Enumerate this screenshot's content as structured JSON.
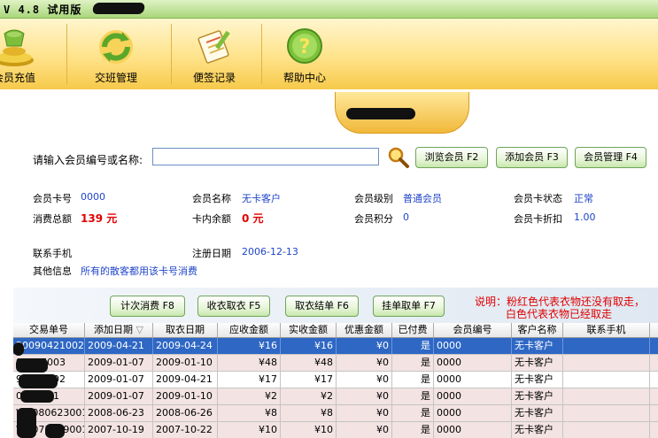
{
  "window": {
    "title": "V 4.8 试用版"
  },
  "toolbar": {
    "buttons": [
      {
        "label": "会员充值",
        "icon": "coins-icon"
      },
      {
        "label": "交班管理",
        "icon": "refresh-icon"
      },
      {
        "label": "便签记录",
        "icon": "notepad-icon"
      },
      {
        "label": "帮助中心",
        "icon": "help-icon"
      }
    ]
  },
  "search": {
    "label": "请输入会员编号或名称:",
    "value": "",
    "placeholder": ""
  },
  "actions": {
    "browse": "浏览会员 F2",
    "add": "添加会员 F3",
    "manage": "会员管理 F4"
  },
  "member": {
    "card_no_label": "会员卡号",
    "card_no": "0000",
    "name_label": "会员名称",
    "name": "无卡客户",
    "level_label": "会员级别",
    "level": "普通会员",
    "status_label": "会员卡状态",
    "status": "正常",
    "total_label": "消费总额",
    "total": "139 元",
    "balance_label": "卡内余额",
    "balance": "0 元",
    "points_label": "会员积分",
    "points": "0",
    "discount_label": "会员卡折扣",
    "discount": "1.00",
    "phone_label": "联系手机",
    "phone": "",
    "reg_label": "注册日期",
    "reg_date": "2006-12-13",
    "other_label": "其他信息",
    "other": "所有的散客都用该卡号消费"
  },
  "ops": {
    "count": "计次消费 F8",
    "wash": "收衣取衣 F5",
    "settle": "取衣结单 F6",
    "hang": "挂单取单 F7"
  },
  "note": {
    "line1": "说明：粉红色代表衣物还没有取走，",
    "line2": "白色代表衣物已经取走"
  },
  "table": {
    "columns": [
      "交易单号",
      "添加日期",
      "取衣日期",
      "应收金额",
      "实收金额",
      "优惠金额",
      "已付费",
      "会员编号",
      "客户名称",
      "联系手机"
    ],
    "sort_indicator": "▽",
    "rows": [
      {
        "id": "20090421002",
        "add": "2009-04-21",
        "pick": "2009-04-24",
        "due": "¥16",
        "paid": "¥16",
        "disc": "¥0",
        "payed": "是",
        "member": "0000",
        "cust": "无卡客户",
        "phone": "",
        "style": "sel"
      },
      {
        "id": "90107003",
        "add": "2009-01-07",
        "pick": "2009-01-10",
        "due": "¥48",
        "paid": "¥48",
        "disc": "¥0",
        "payed": "是",
        "member": "0000",
        "cust": "无卡客户",
        "phone": "",
        "style": "pink"
      },
      {
        "id": "90107002",
        "add": "2009-01-07",
        "pick": "2009-04-21",
        "due": "¥17",
        "paid": "¥17",
        "disc": "¥0",
        "payed": "是",
        "member": "0000",
        "cust": "无卡客户",
        "phone": "",
        "style": "white"
      },
      {
        "id": "0107001",
        "add": "2009-01-07",
        "pick": "2009-01-10",
        "due": "¥2",
        "paid": "¥2",
        "disc": "¥0",
        "payed": "是",
        "member": "0000",
        "cust": "无卡客户",
        "phone": "",
        "style": "pink"
      },
      {
        "id": "WB080623001",
        "add": "2008-06-23",
        "pick": "2008-06-26",
        "due": "¥8",
        "paid": "¥8",
        "disc": "¥0",
        "payed": "是",
        "member": "0000",
        "cust": "无卡客户",
        "phone": "",
        "style": "pink"
      },
      {
        "id": "WB071019001",
        "add": "2007-10-19",
        "pick": "2007-10-22",
        "due": "¥10",
        "paid": "¥10",
        "disc": "¥0",
        "payed": "是",
        "member": "0000",
        "cust": "无卡客户",
        "phone": "",
        "style": "pink"
      }
    ]
  },
  "colors": {
    "accent": "#2e67c4",
    "pending": "#f3e3e3",
    "value_text": "#1f45c9",
    "alert": "#e00000"
  }
}
